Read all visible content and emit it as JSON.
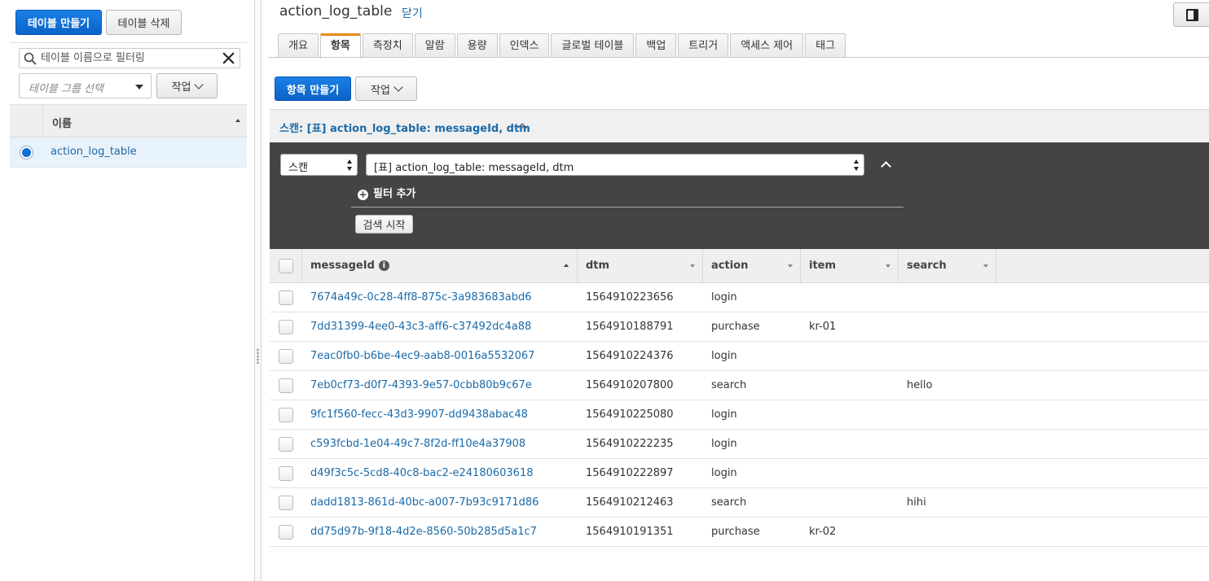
{
  "left_panel": {
    "create_table_label": "테이블 만들기",
    "delete_table_label": "테이블 삭제",
    "filter_placeholder": "테이블 이름으로 필터링",
    "group_select_placeholder": "테이블 그룹 선택",
    "actions_label": "작업",
    "column_name": "이름",
    "tables": [
      {
        "name": "action_log_table",
        "selected": true
      }
    ]
  },
  "header": {
    "table_name": "action_log_table",
    "close_label": "닫기"
  },
  "tabs": [
    "개요",
    "항목",
    "측정치",
    "알람",
    "용량",
    "인덱스",
    "글로벌 테이블",
    "백업",
    "트리거",
    "액세스 제어",
    "태그"
  ],
  "active_tab": "항목",
  "toolbar": {
    "create_item_label": "항목 만들기",
    "actions_label": "작업"
  },
  "scan": {
    "title": "스캔: [표] action_log_table: messageId, dtm",
    "mode": "스캔",
    "index": "[표] action_log_table: messageId, dtm",
    "add_filter_label": "필터 추가",
    "start_search_label": "검색 시작"
  },
  "results": {
    "columns": [
      "messageId",
      "dtm",
      "action",
      "item",
      "search"
    ],
    "rows": [
      {
        "messageId": "7674a49c-0c28-4ff8-875c-3a983683abd6",
        "dtm": "1564910223656",
        "action": "login",
        "item": "",
        "search": ""
      },
      {
        "messageId": "7dd31399-4ee0-43c3-aff6-c37492dc4a88",
        "dtm": "1564910188791",
        "action": "purchase",
        "item": "kr-01",
        "search": ""
      },
      {
        "messageId": "7eac0fb0-b6be-4ec9-aab8-0016a5532067",
        "dtm": "1564910224376",
        "action": "login",
        "item": "",
        "search": ""
      },
      {
        "messageId": "7eb0cf73-d0f7-4393-9e57-0cbb80b9c67e",
        "dtm": "1564910207800",
        "action": "search",
        "item": "",
        "search": "hello"
      },
      {
        "messageId": "9fc1f560-fecc-43d3-9907-dd9438abac48",
        "dtm": "1564910225080",
        "action": "login",
        "item": "",
        "search": ""
      },
      {
        "messageId": "c593fcbd-1e04-49c7-8f2d-ff10e4a37908",
        "dtm": "1564910222235",
        "action": "login",
        "item": "",
        "search": ""
      },
      {
        "messageId": "d49f3c5c-5cd8-40c8-bac2-e24180603618",
        "dtm": "1564910222897",
        "action": "login",
        "item": "",
        "search": ""
      },
      {
        "messageId": "dadd1813-861d-40bc-a007-7b93c9171d86",
        "dtm": "1564910212463",
        "action": "search",
        "item": "",
        "search": "hihi"
      },
      {
        "messageId": "dd75d97b-9f18-4d2e-8560-50b285d5a1c7",
        "dtm": "1564910191351",
        "action": "purchase",
        "item": "kr-02",
        "search": ""
      }
    ]
  },
  "colors": {
    "primary": "#0f6ed6",
    "link": "#1b6aa8",
    "active_tab_accent": "#e98a17",
    "scan_panel_bg": "#444444"
  },
  "icons": [
    "search-icon",
    "clear-icon",
    "chevron-down-icon",
    "chevron-up-icon",
    "info-icon",
    "plus-circle-icon",
    "split-panel-icon",
    "sort-asc-icon"
  ]
}
